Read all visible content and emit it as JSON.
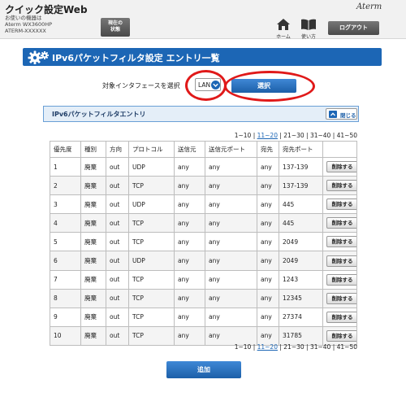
{
  "header": {
    "title": "クイック設定Web",
    "device_line1": "お使いの機器は",
    "device_line2": "Aterm WX3600HP",
    "device_line3": "ATERM-XXXXXX",
    "status_button_line1": "現在の",
    "status_button_line2": "状態",
    "brand": "Aterm",
    "home_label": "ホーム",
    "guide_label": "使い方",
    "logout_label": "ログアウト"
  },
  "page": {
    "title": "IPv6パケットフィルタ設定 エントリ一覧"
  },
  "interface": {
    "label": "対象インタフェースを選択",
    "selected": "LAN",
    "select_button": "選択"
  },
  "section": {
    "title": "IPv6パケットフィルタエントリ",
    "collapse_label": "閉じる"
  },
  "pager": {
    "items": [
      "1~10",
      "11~20",
      "21~30",
      "31~40",
      "41~50"
    ],
    "active_index": 1
  },
  "table": {
    "headers": [
      "優先度",
      "種別",
      "方向",
      "プロトコル",
      "送信元",
      "送信元ポート",
      "宛先",
      "宛先ポート",
      ""
    ],
    "rows": [
      {
        "priority": "1",
        "type": "廃棄",
        "direction": "out",
        "protocol": "UDP",
        "src": "any",
        "src_port": "any",
        "dst": "any",
        "dst_port": "137-139",
        "delete": "削除する"
      },
      {
        "priority": "2",
        "type": "廃棄",
        "direction": "out",
        "protocol": "TCP",
        "src": "any",
        "src_port": "any",
        "dst": "any",
        "dst_port": "137-139",
        "delete": "削除する"
      },
      {
        "priority": "3",
        "type": "廃棄",
        "direction": "out",
        "protocol": "UDP",
        "src": "any",
        "src_port": "any",
        "dst": "any",
        "dst_port": "445",
        "delete": "削除する"
      },
      {
        "priority": "4",
        "type": "廃棄",
        "direction": "out",
        "protocol": "TCP",
        "src": "any",
        "src_port": "any",
        "dst": "any",
        "dst_port": "445",
        "delete": "削除する"
      },
      {
        "priority": "5",
        "type": "廃棄",
        "direction": "out",
        "protocol": "TCP",
        "src": "any",
        "src_port": "any",
        "dst": "any",
        "dst_port": "2049",
        "delete": "削除する"
      },
      {
        "priority": "6",
        "type": "廃棄",
        "direction": "out",
        "protocol": "UDP",
        "src": "any",
        "src_port": "any",
        "dst": "any",
        "dst_port": "2049",
        "delete": "削除する"
      },
      {
        "priority": "7",
        "type": "廃棄",
        "direction": "out",
        "protocol": "TCP",
        "src": "any",
        "src_port": "any",
        "dst": "any",
        "dst_port": "1243",
        "delete": "削除する"
      },
      {
        "priority": "8",
        "type": "廃棄",
        "direction": "out",
        "protocol": "TCP",
        "src": "any",
        "src_port": "any",
        "dst": "any",
        "dst_port": "12345",
        "delete": "削除する"
      },
      {
        "priority": "9",
        "type": "廃棄",
        "direction": "out",
        "protocol": "TCP",
        "src": "any",
        "src_port": "any",
        "dst": "any",
        "dst_port": "27374",
        "delete": "削除する"
      },
      {
        "priority": "10",
        "type": "廃棄",
        "direction": "out",
        "protocol": "TCP",
        "src": "any",
        "src_port": "any",
        "dst": "any",
        "dst_port": "31785",
        "delete": "削除する"
      }
    ]
  },
  "add_button": "追加",
  "colors": {
    "accent": "#1c66b5",
    "highlight_ring": "#e01919",
    "section_bg": "#e4eef8"
  },
  "icons": [
    "home-icon",
    "book-icon",
    "gear-icon",
    "chevron-down-icon",
    "chevron-up-icon"
  ]
}
